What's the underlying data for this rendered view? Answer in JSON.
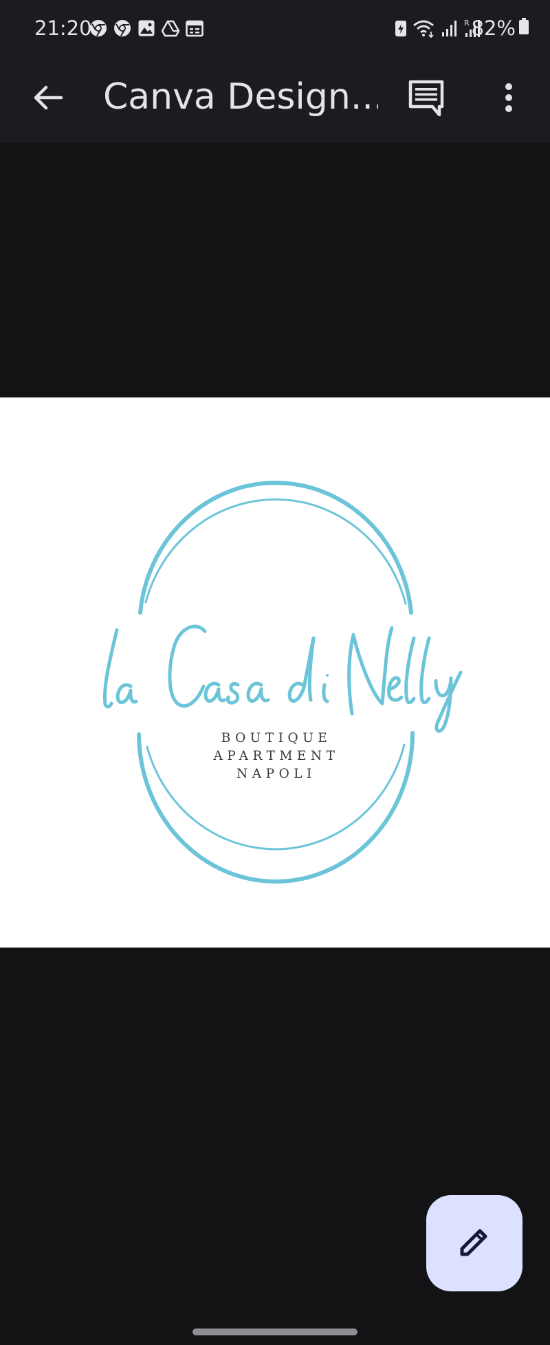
{
  "status_bar": {
    "time": "21:20",
    "left_icons": [
      "chrome-icon",
      "chrome-icon",
      "gallery-icon",
      "drive-icon",
      "calendar-icon"
    ],
    "right_icons": [
      "battery-saver-icon",
      "wifi-icon",
      "signal-icon",
      "roaming-signal-icon"
    ],
    "battery_percent": "82%"
  },
  "app_bar": {
    "back_icon": "arrow-back-icon",
    "title": "Canva Design....",
    "comments_icon": "comment-icon",
    "more_icon": "more-vert-icon"
  },
  "logo": {
    "script_text": "la Casa di Nelly",
    "line1": "BOUTIQUE",
    "line2": "APARTMENT",
    "line3": "NAPOLI",
    "accent_color": "#6cc4d9"
  },
  "fab": {
    "icon": "edit-pencil-icon"
  },
  "colors": {
    "background": "#131316",
    "app_bar": "#1b1c21",
    "fab": "#dbe1ff"
  }
}
